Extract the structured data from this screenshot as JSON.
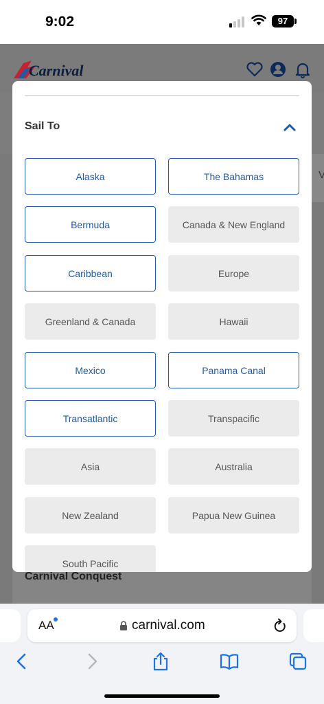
{
  "status_bar": {
    "time": "9:02",
    "battery": "97"
  },
  "site": {
    "logo_text": "Carnival",
    "bg_card_title": "Carnival Conquest",
    "bg_right_letter": "V"
  },
  "filter_modal": {
    "section_title": "Sail To",
    "destinations": [
      {
        "label": "Alaska",
        "selected": true
      },
      {
        "label": "The Bahamas",
        "selected": true
      },
      {
        "label": "Bermuda",
        "selected": true
      },
      {
        "label": "Canada & New England",
        "selected": false
      },
      {
        "label": "Caribbean",
        "selected": true
      },
      {
        "label": "Europe",
        "selected": false
      },
      {
        "label": "Greenland & Canada",
        "selected": false
      },
      {
        "label": "Hawaii",
        "selected": false
      },
      {
        "label": "Mexico",
        "selected": true
      },
      {
        "label": "Panama Canal",
        "selected": true
      },
      {
        "label": "Transatlantic",
        "selected": true
      },
      {
        "label": "Transpacific",
        "selected": false
      },
      {
        "label": "Asia",
        "selected": false
      },
      {
        "label": "Australia",
        "selected": false
      },
      {
        "label": "New Zealand",
        "selected": false
      },
      {
        "label": "Papua New Guinea",
        "selected": false
      },
      {
        "label": "South Pacific",
        "selected": false
      }
    ]
  },
  "browser": {
    "text_size_label": "AA",
    "url": "carnival.com"
  },
  "colors": {
    "accent_blue": "#1d5ba8",
    "unselected_bg": "#ebebeb",
    "logo_red": "#c8202f"
  }
}
